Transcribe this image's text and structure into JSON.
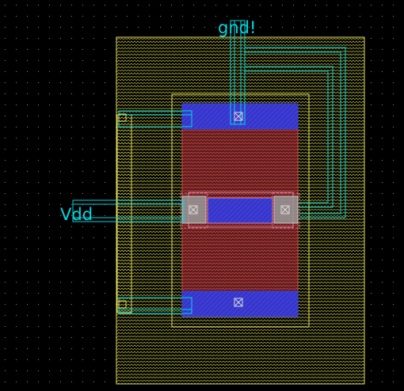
{
  "labels": {
    "gnd": "gnd!",
    "vdd": "Vdd"
  },
  "colors": {
    "background": "#000000",
    "grid_dot": "#8a8a8a",
    "outline": "#e8e060",
    "hatch": "#c0c040",
    "cyan": "#00d8e0",
    "diffusion": "#3333cc",
    "poly": "#c04040",
    "pink": "#e080a0",
    "white_box": "#dddddd"
  },
  "icons": {
    "pin_marker": "x-square-icon"
  }
}
